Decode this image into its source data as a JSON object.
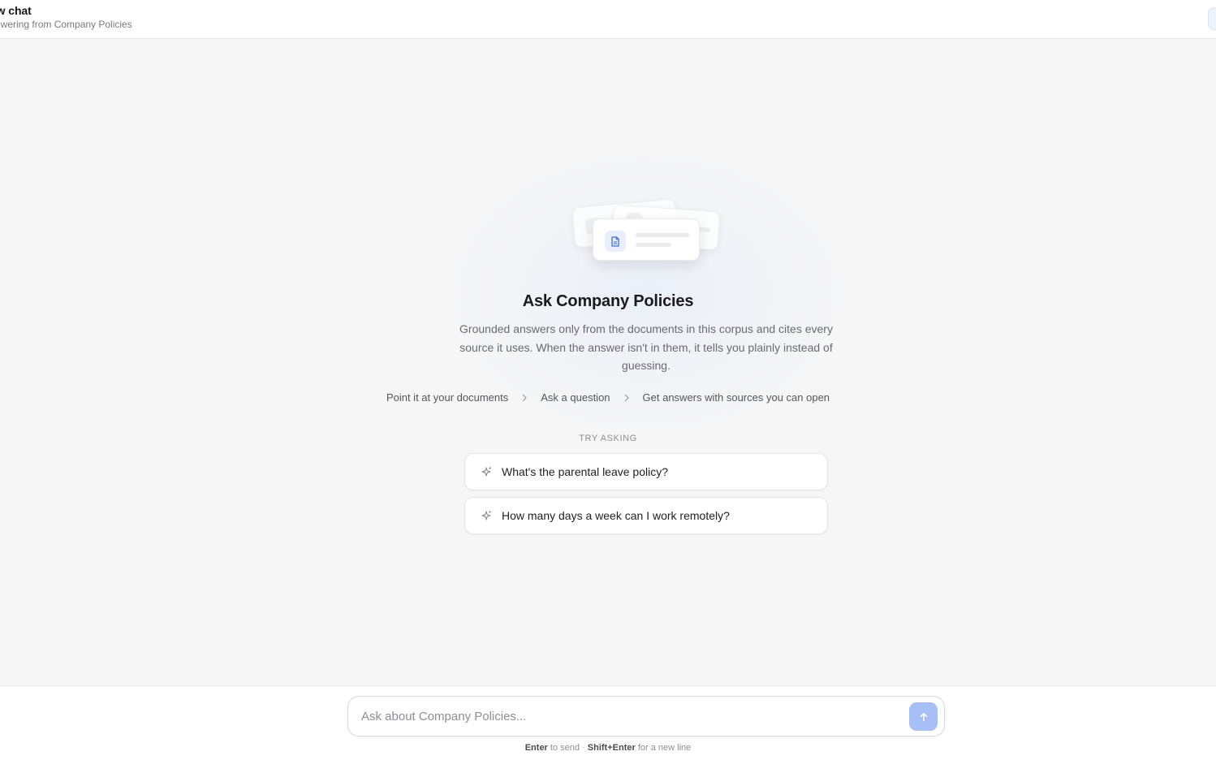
{
  "header": {
    "title": "ew chat",
    "subtitle": "nswering from Company Policies"
  },
  "empty_state": {
    "title": "Ask Company Policies",
    "description": "Grounded answers only from the documents in this corpus and cites every source it uses. When the answer isn't in them, it tells you plainly instead of guessing.",
    "steps": [
      "Point it at your documents",
      "Ask a question",
      "Get answers with sources you can open"
    ],
    "try_label": "TRY ASKING",
    "suggestions": [
      "What's the parental leave policy?",
      "How many days a week can I work remotely?"
    ]
  },
  "composer": {
    "placeholder": "Ask about Company Policies...",
    "value": "",
    "send_icon": "arrow-up-icon"
  },
  "hint": {
    "key_send": "Enter",
    "text_send": "to send ·",
    "key_newline": "Shift+Enter",
    "text_newline": "for a new line"
  },
  "colors": {
    "accent": "#a8bef6",
    "doc_icon": "#3b6fe0",
    "background": "#f6f6f7"
  }
}
